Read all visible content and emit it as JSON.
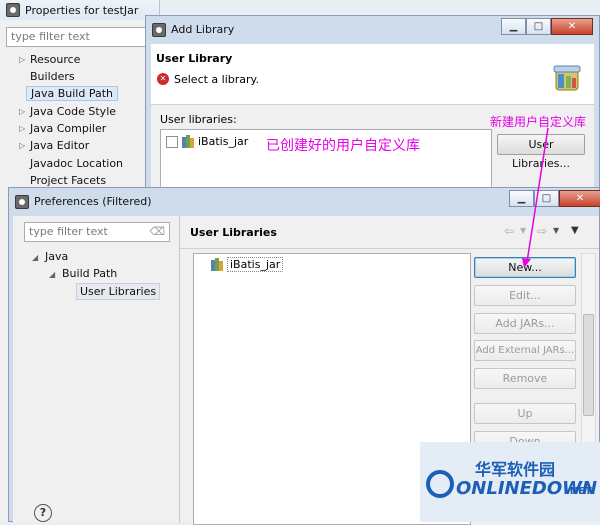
{
  "properties": {
    "title": "Properties for testJar",
    "filter_placeholder": "type filter text",
    "items": [
      "Resource",
      "Builders",
      "Java Build Path",
      "Java Code Style",
      "Java Compiler",
      "Java Editor",
      "Javadoc Location",
      "Project Facets"
    ]
  },
  "add_library": {
    "title": "Add Library",
    "header_title": "User Library",
    "header_message": "Select a library.",
    "section_label": "User libraries:",
    "library_item": "iBatis_jar",
    "user_libraries_button": "User Libraries..."
  },
  "annotations": {
    "created_library": "已创建好的用户自定义库",
    "new_library": "新建用户自定义库"
  },
  "preferences": {
    "title": "Preferences (Filtered)",
    "filter_placeholder": "type filter text",
    "tree": [
      "Java",
      "Build Path",
      "User Libraries"
    ],
    "panel_title": "User Libraries",
    "library_item": "iBatis_jar",
    "buttons": [
      "New...",
      "Edit...",
      "Add JARs...",
      "Add External JARs...",
      "Remove",
      "Up",
      "Down"
    ]
  },
  "watermark": {
    "text_top": "华军软件园",
    "text_bottom": "ONLINEDOWN",
    "suffix": ".NET"
  },
  "colors": {
    "annotation": "#e800e8",
    "window_frame": "#cfdcec",
    "error": "#cc2b2b",
    "watermark_blue": "#1c5fb6"
  },
  "icons": [
    "window-icon",
    "error-icon",
    "library-icon",
    "jar-icon",
    "back-arrow-icon",
    "forward-arrow-icon",
    "view-menu-icon",
    "help-icon",
    "clear-filter-icon"
  ]
}
